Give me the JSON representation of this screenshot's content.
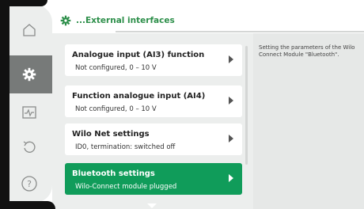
{
  "header": {
    "title": "...External interfaces",
    "icon": "gear-icon"
  },
  "rail": {
    "items": [
      {
        "icon": "home-icon",
        "active": false
      },
      {
        "icon": "settings-icon",
        "active": true
      },
      {
        "icon": "diagnostics-icon",
        "active": false
      },
      {
        "icon": "restore-icon",
        "active": false
      },
      {
        "icon": "help-icon",
        "active": false
      }
    ]
  },
  "menu": {
    "items": [
      {
        "title": "Analogue input (AI3) function",
        "subtitle": "Not configured, 0 – 10 V",
        "selected": false
      },
      {
        "title": "Function analogue input (AI4)",
        "subtitle": "Not configured, 0 – 10 V",
        "selected": false
      },
      {
        "title": "Wilo Net settings",
        "subtitle": "ID0, termination: switched off",
        "selected": false
      },
      {
        "title": "Bluetooth settings",
        "subtitle": "Wilo-Connect module plugged",
        "selected": true
      }
    ]
  },
  "info": {
    "text": "Setting the parameters of the Wilo Connect Module \"Bluetooth\"."
  },
  "colors": {
    "accent_green": "#109c5a",
    "header_green": "#2d8f4a",
    "rail_active": "#777a79",
    "background": "#eceeed"
  }
}
